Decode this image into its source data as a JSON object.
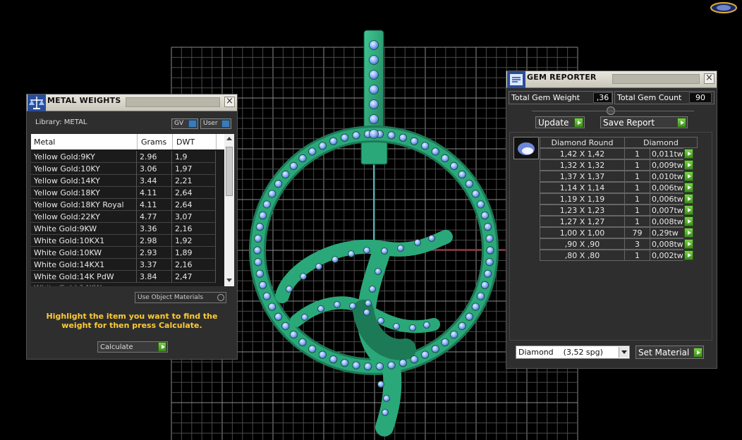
{
  "metal_weights": {
    "title": "METAL WEIGHTS",
    "close": "×",
    "library_label": "Library: METAL",
    "gv_label": "GV",
    "user_label": "User",
    "columns": [
      "Metal",
      "Grams",
      "DWT"
    ],
    "rows": [
      {
        "metal": "Yellow Gold:9KY",
        "grams": "2.96",
        "dwt": "1,9"
      },
      {
        "metal": "Yellow Gold:10KY",
        "grams": "3.06",
        "dwt": "1,97"
      },
      {
        "metal": "Yellow Gold:14KY",
        "grams": "3.44",
        "dwt": "2,21"
      },
      {
        "metal": "Yellow Gold:18KY",
        "grams": "4.11",
        "dwt": "2,64"
      },
      {
        "metal": "Yellow Gold:18KY Royal",
        "grams": "4.11",
        "dwt": "2,64"
      },
      {
        "metal": "Yellow Gold:22KY",
        "grams": "4.77",
        "dwt": "3,07"
      },
      {
        "metal": "White Gold:9KW",
        "grams": "3.36",
        "dwt": "2,16"
      },
      {
        "metal": "White Gold:10KX1",
        "grams": "2.98",
        "dwt": "1,92"
      },
      {
        "metal": "White Gold:10KW",
        "grams": "2.93",
        "dwt": "1,89"
      },
      {
        "metal": "White Gold:14KX1",
        "grams": "3.37",
        "dwt": "2,16"
      },
      {
        "metal": "White Gold:14K PdW",
        "grams": "3.84",
        "dwt": "2,47"
      }
    ],
    "use_object_materials": "Use Object Materials",
    "instruction": "Highlight the item you want to find the weight for then press Calculate.",
    "calculate_label": "Calculate"
  },
  "gem_reporter": {
    "title": "GEM REPORTER",
    "close": "×",
    "total_gem_weight_label": "Total Gem Weight",
    "total_gem_weight_value": ",36",
    "total_gem_count_label": "Total Gem Count",
    "total_gem_count_value": "90",
    "update_label": "Update",
    "save_report_label": "Save Report",
    "table_headers": [
      "Diamond Round",
      "Diamond"
    ],
    "rows": [
      {
        "size": "1,42 X 1,42",
        "count": "1",
        "weight": "0,011tw"
      },
      {
        "size": "1,32 X 1,32",
        "count": "1",
        "weight": "0,009tw"
      },
      {
        "size": "1,37 X 1,37",
        "count": "1",
        "weight": "0,010tw"
      },
      {
        "size": "1,14 X 1,14",
        "count": "1",
        "weight": "0,006tw"
      },
      {
        "size": "1,19 X 1,19",
        "count": "1",
        "weight": "0,006tw"
      },
      {
        "size": "1,23 X 1,23",
        "count": "1",
        "weight": "0,007tw"
      },
      {
        "size": "1,27 X 1,27",
        "count": "1",
        "weight": "0,008tw"
      },
      {
        "size": "1,00 X 1,00",
        "count": "79",
        "weight": "0,29tw"
      },
      {
        "size": ",90 X ,90",
        "count": "3",
        "weight": "0,008tw"
      },
      {
        "size": ",80 X ,80",
        "count": "1",
        "weight": "0,002tw"
      }
    ],
    "material_select": "Diamond    (3,52 spg)",
    "set_material_label": "Set Material"
  },
  "colors": {
    "background": "#000000",
    "grid": "#6a6a6a",
    "pendant": "#2aa87a",
    "gem": "#8fb4ff",
    "instruction_text": "#ffcc33",
    "axis_red": "#c8102e",
    "axis_teal": "#3fb8c0"
  }
}
